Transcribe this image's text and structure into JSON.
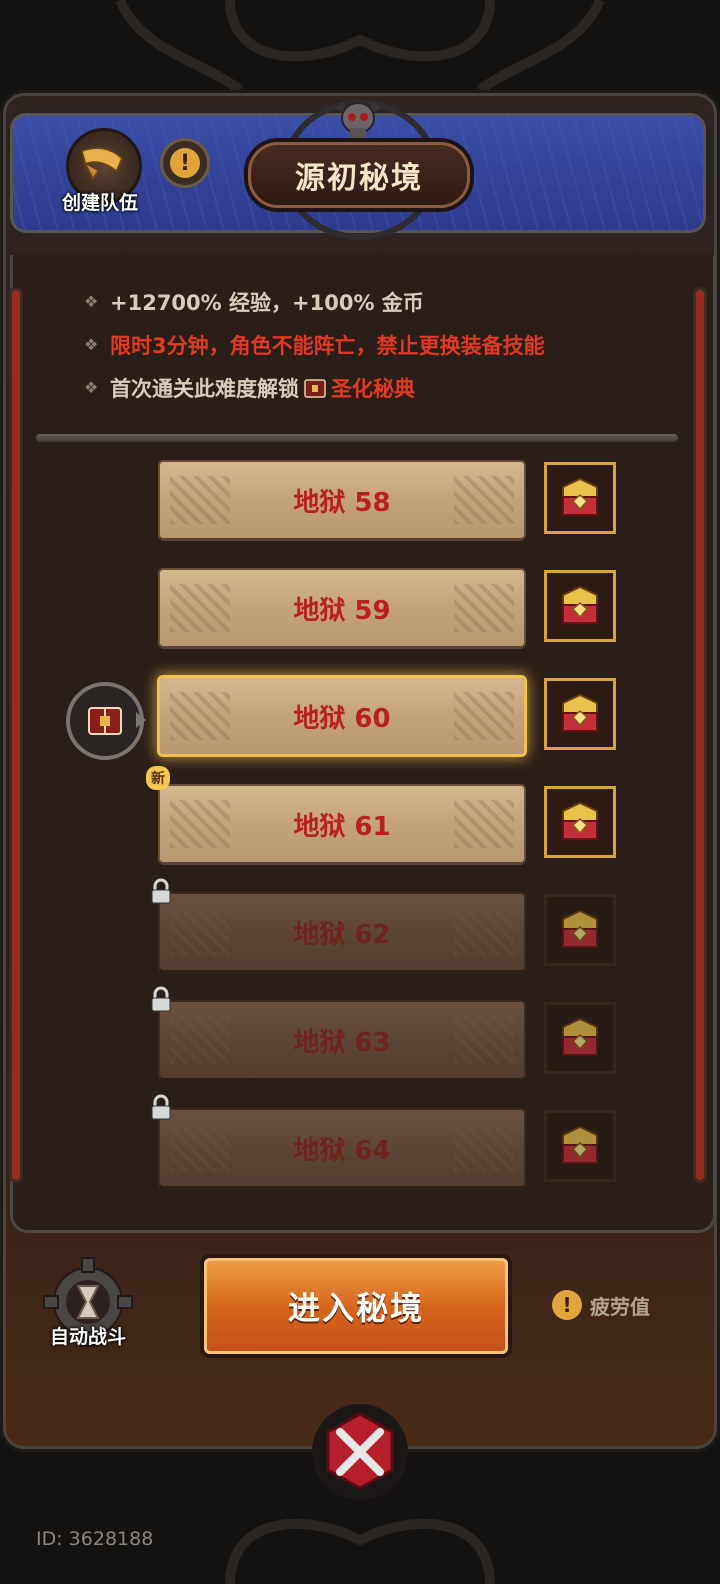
{
  "header": {
    "title": "源初秘境",
    "team_label": "创建队伍"
  },
  "description": {
    "exp_line": "+12700% 经验，+100% 金币",
    "warning_line": "限时3分钟，角色不能阵亡，禁止更换装备技能",
    "unlock_prefix": "首次通关此难度解锁",
    "unlock_reward": "圣化秘典"
  },
  "levels": [
    {
      "label": "地狱 58",
      "state": "unlocked"
    },
    {
      "label": "地狱 59",
      "state": "unlocked"
    },
    {
      "label": "地狱 60",
      "state": "selected"
    },
    {
      "label": "地狱 61",
      "state": "new",
      "badge": "新"
    },
    {
      "label": "地狱 62",
      "state": "locked"
    },
    {
      "label": "地狱 63",
      "state": "locked"
    },
    {
      "label": "地狱 64",
      "state": "locked"
    }
  ],
  "bottom": {
    "auto_battle_label": "自动战斗",
    "enter_label": "进入秘境",
    "fatigue_label": "疲劳值",
    "fatigue_icon": "!"
  },
  "footer": {
    "id_text": "ID: 3628188"
  },
  "colors": {
    "accent_red": "#e23a22",
    "gold": "#d9a53a",
    "enter_orange": "#d6661c"
  }
}
